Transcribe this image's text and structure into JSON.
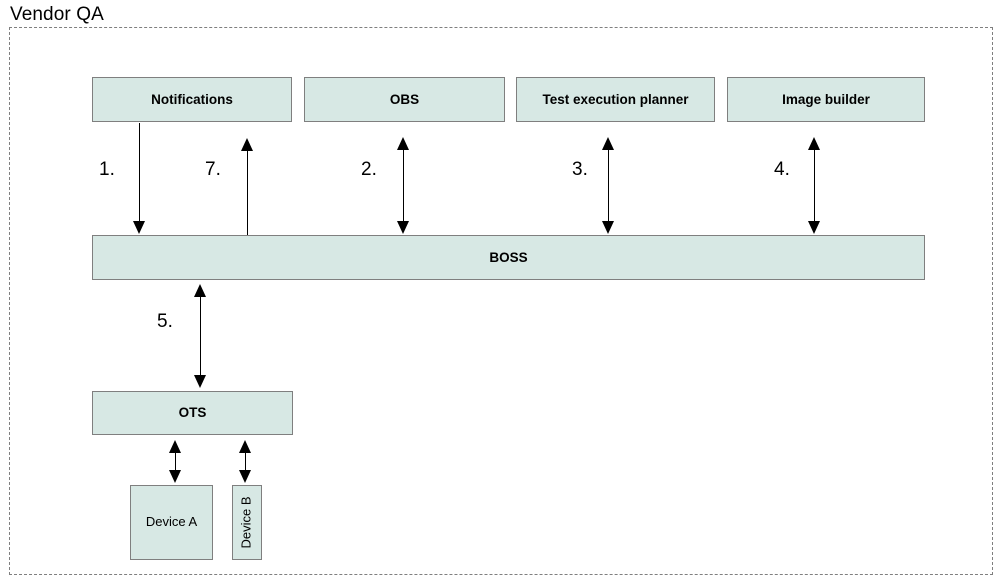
{
  "diagram": {
    "boundary_label": "Vendor QA",
    "fill_color": "#d7e8e4",
    "stroke_color": "#7f7f7f",
    "line_color": "#000000",
    "nodes": {
      "notifications": "Notifications",
      "obs": "OBS",
      "test_execution_planner": "Test execution planner",
      "image_builder": "Image builder",
      "boss": "BOSS",
      "ots": "OTS",
      "device_a": "Device A",
      "device_b": "Device B"
    },
    "edge_labels": {
      "e1": "1.",
      "e7": "7.",
      "e2": "2.",
      "e3": "3.",
      "e4": "4.",
      "e5": "5."
    }
  }
}
